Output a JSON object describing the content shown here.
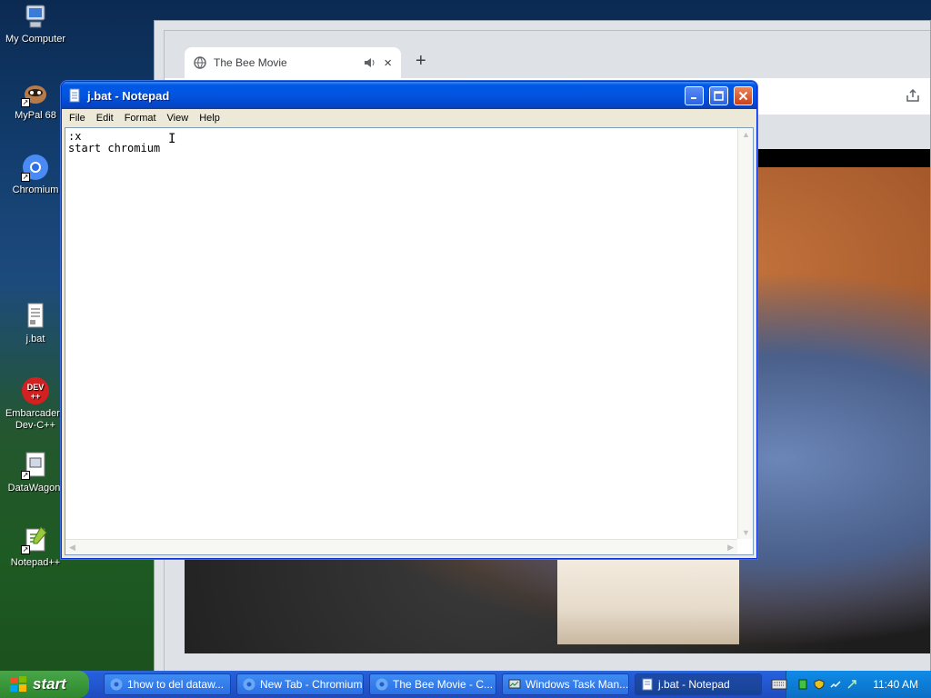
{
  "desktop": {
    "icons": [
      {
        "label": "My Computer"
      },
      {
        "label": "MyPal 68"
      },
      {
        "label": "Chromium"
      },
      {
        "label": "j.bat"
      },
      {
        "label": "Embarcadero Dev-C++"
      },
      {
        "label": "DataWagon."
      },
      {
        "label": "Notepad++"
      }
    ]
  },
  "browser": {
    "tab_title": "The Bee Movie",
    "new_tab_symbol": "+",
    "close_symbol": "×"
  },
  "notepad": {
    "title": "j.bat - Notepad",
    "menu": [
      "File",
      "Edit",
      "Format",
      "View",
      "Help"
    ],
    "content": ":x\nstart chromium"
  },
  "taskbar": {
    "start_label": "start",
    "buttons": [
      {
        "label": "1how to del dataw..."
      },
      {
        "label": "New Tab - Chromium"
      },
      {
        "label": "The Bee Movie - C..."
      },
      {
        "label": "Windows Task Man..."
      },
      {
        "label": "j.bat - Notepad"
      }
    ],
    "clock": "11:40 AM"
  },
  "colors": {
    "xp_blue": "#0254e0",
    "start_green": "#3c9a3c",
    "tray_blue": "#0d7dd6"
  }
}
